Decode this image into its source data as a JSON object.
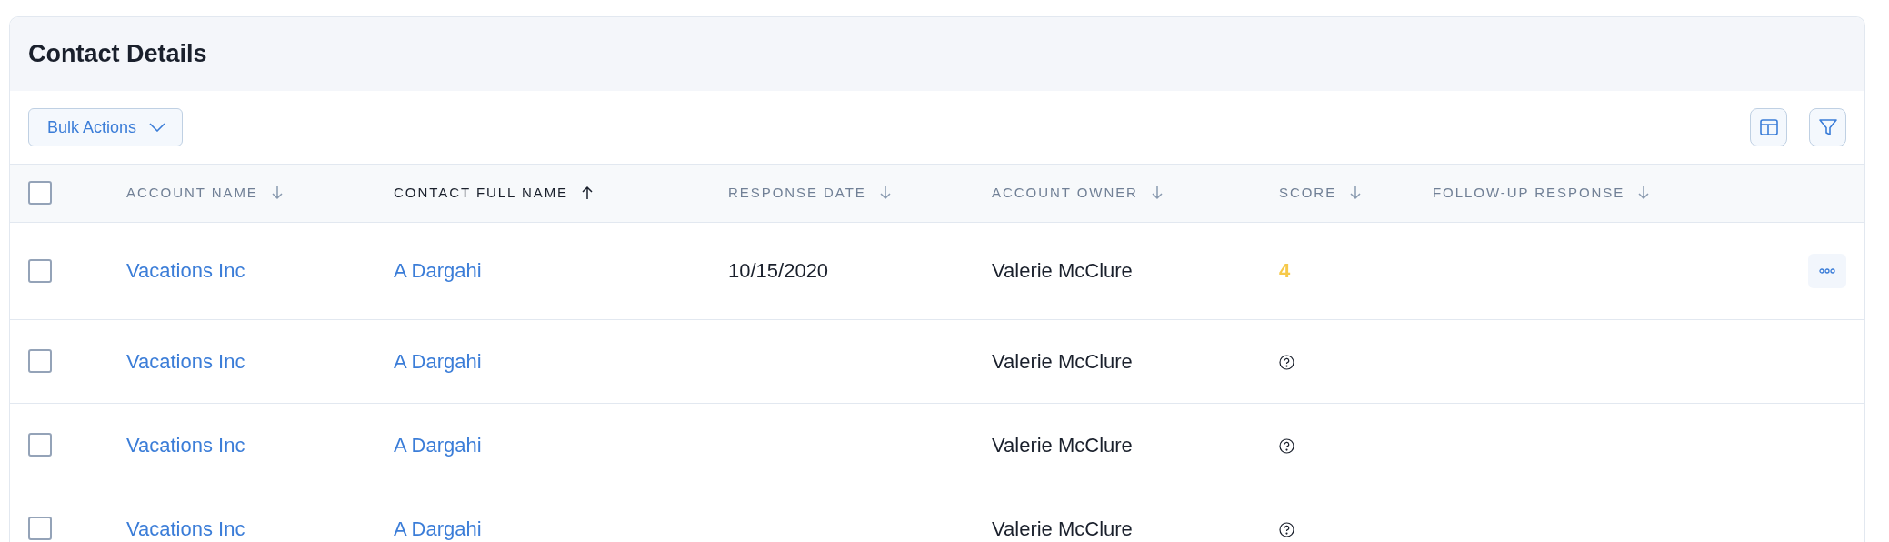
{
  "title": "Contact Details",
  "toolbar": {
    "bulk_actions": "Bulk Actions"
  },
  "table": {
    "select_all": {
      "checked": false
    },
    "columns": [
      {
        "label": "ACCOUNT NAME",
        "sort_ascending": false,
        "active": false
      },
      {
        "label": "CONTACT FULL NAME",
        "sort_ascending": true,
        "active": true
      },
      {
        "label": "RESPONSE DATE",
        "sort_ascending": false,
        "active": false
      },
      {
        "label": "ACCOUNT OWNER",
        "sort_ascending": false,
        "active": false
      },
      {
        "label": "SCORE",
        "sort_ascending": false,
        "active": false
      },
      {
        "label": "FOLLOW-UP RESPONSE",
        "sort_ascending": false,
        "active": false
      }
    ],
    "rows": [
      {
        "checked": false,
        "account_name": "Vacations Inc",
        "contact_full_name": "A Dargahi",
        "response_date": "10/15/2020",
        "account_owner": "Valerie McClure",
        "score": {
          "kind": "value",
          "text": "4"
        },
        "actions_shown": true
      },
      {
        "checked": false,
        "account_name": "Vacations Inc",
        "contact_full_name": "A Dargahi",
        "account_owner": "Valerie McClure",
        "score": {
          "kind": "unknown"
        },
        "actions_shown": false
      },
      {
        "checked": false,
        "account_name": "Vacations Inc",
        "contact_full_name": "A Dargahi",
        "account_owner": "Valerie McClure",
        "score": {
          "kind": "unknown"
        },
        "actions_shown": false
      },
      {
        "checked": false,
        "account_name": "Vacations Inc",
        "contact_full_name": "A Dargahi",
        "account_owner": "Valerie McClure",
        "score": {
          "kind": "unknown"
        },
        "actions_shown": false
      }
    ]
  }
}
